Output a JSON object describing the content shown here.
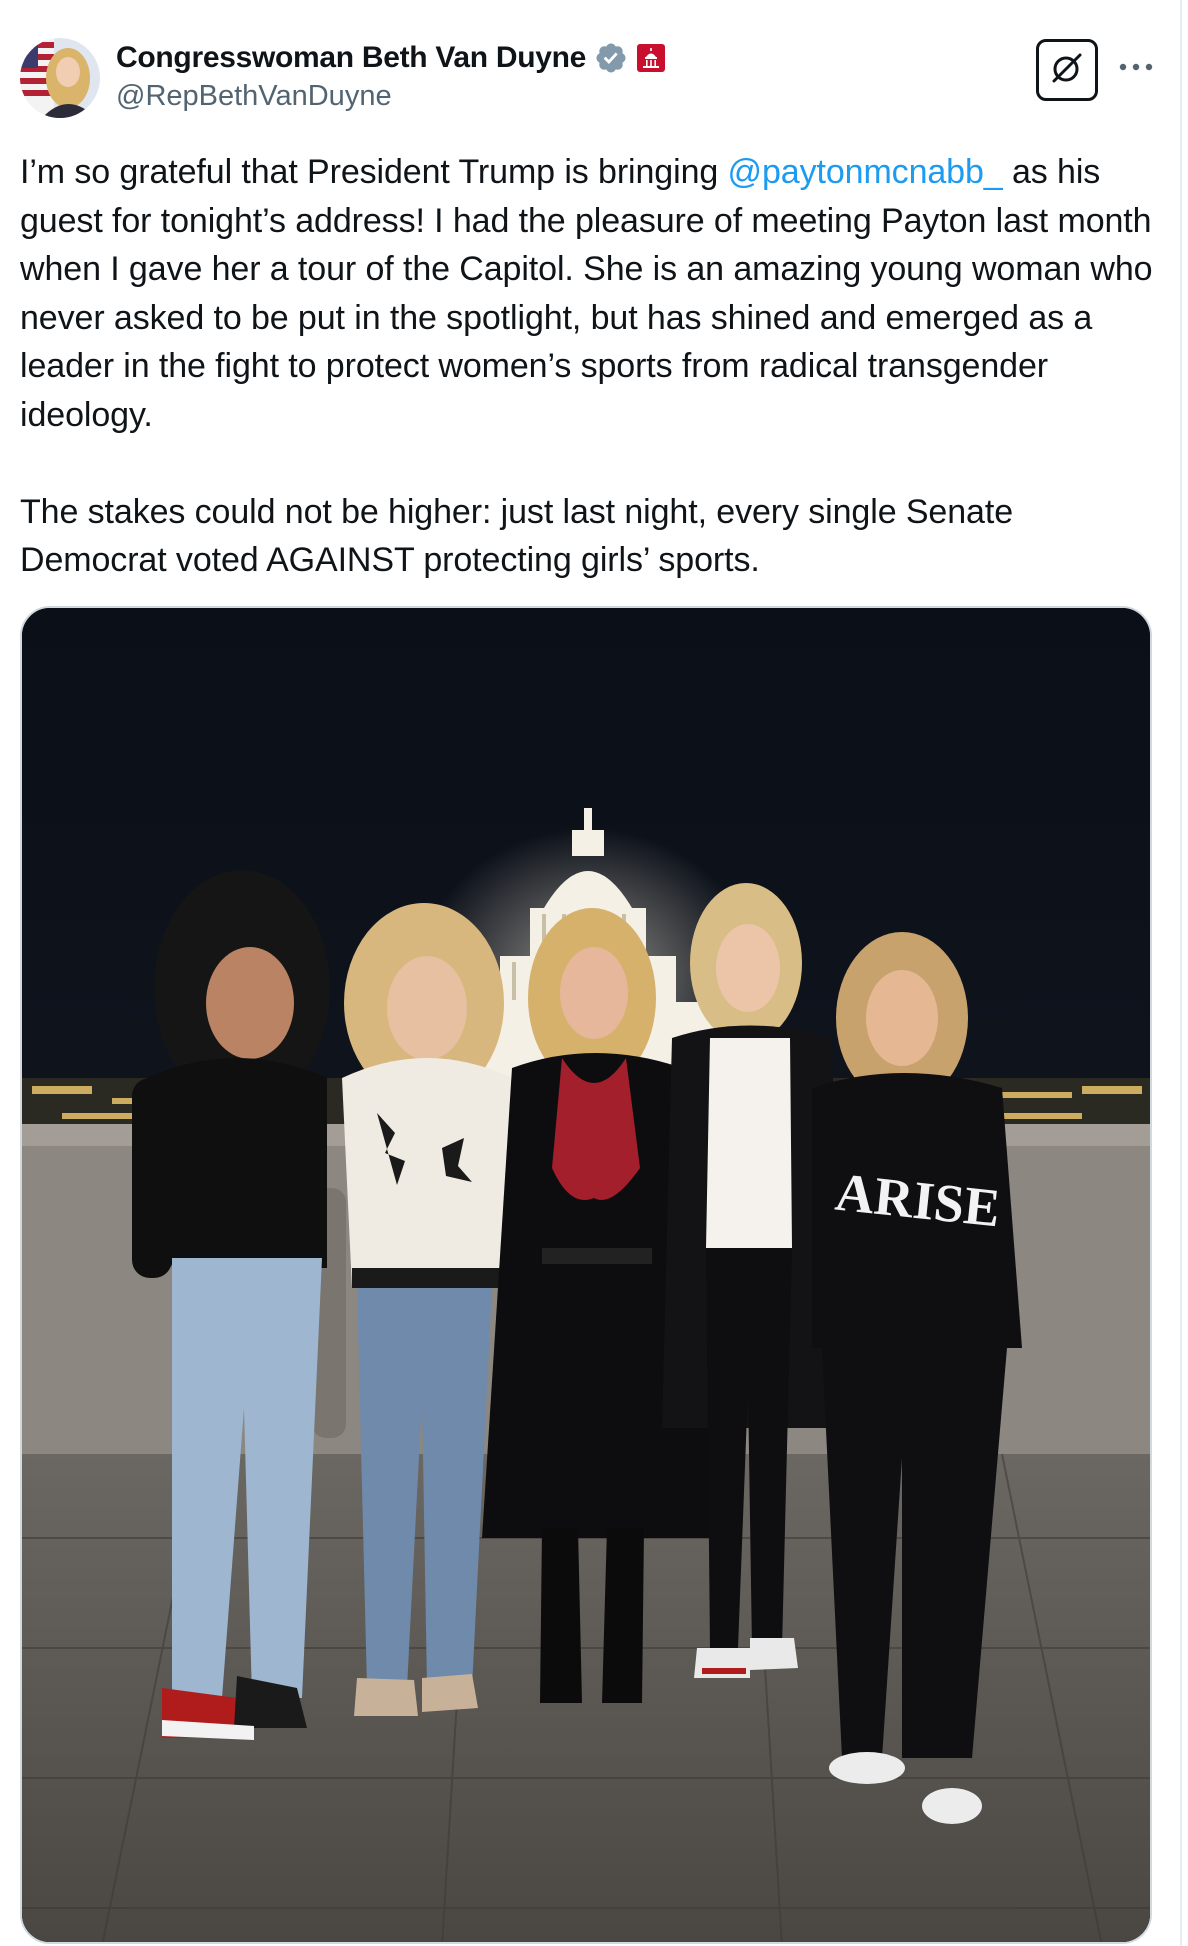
{
  "author": {
    "display_name": "Congresswoman Beth Van Duyne",
    "handle": "@RepBethVanDuyne",
    "verified_icon": "verified-badge-icon",
    "affiliation_icon": "government-badge-icon"
  },
  "actions": {
    "grok_icon": "grok-icon",
    "more_icon": "more-dots-icon"
  },
  "tweet": {
    "p1_before": "I’m so grateful that President Trump is bringing ",
    "mention": "@paytonmcnabb_",
    "p1_after": " as his guest for tonight’s address! I had the pleasure of meeting Payton last month when I gave her a tour of the Capitol. She is an amazing young woman who never asked to be put in the spotlight, but has shined and emerged as a leader in the fight to protect women’s sports from radical transgender ideology.",
    "p2": "The stakes could not be higher: just last night, every single Senate Democrat voted AGAINST protecting girls’ sports."
  },
  "photo": {
    "sweatshirt_text": "ARISE"
  },
  "colors": {
    "text": "#0f1419",
    "secondary": "#536471",
    "link": "#1d9bf0",
    "verified": "#829aab",
    "gov_badge": "#c8102e"
  }
}
